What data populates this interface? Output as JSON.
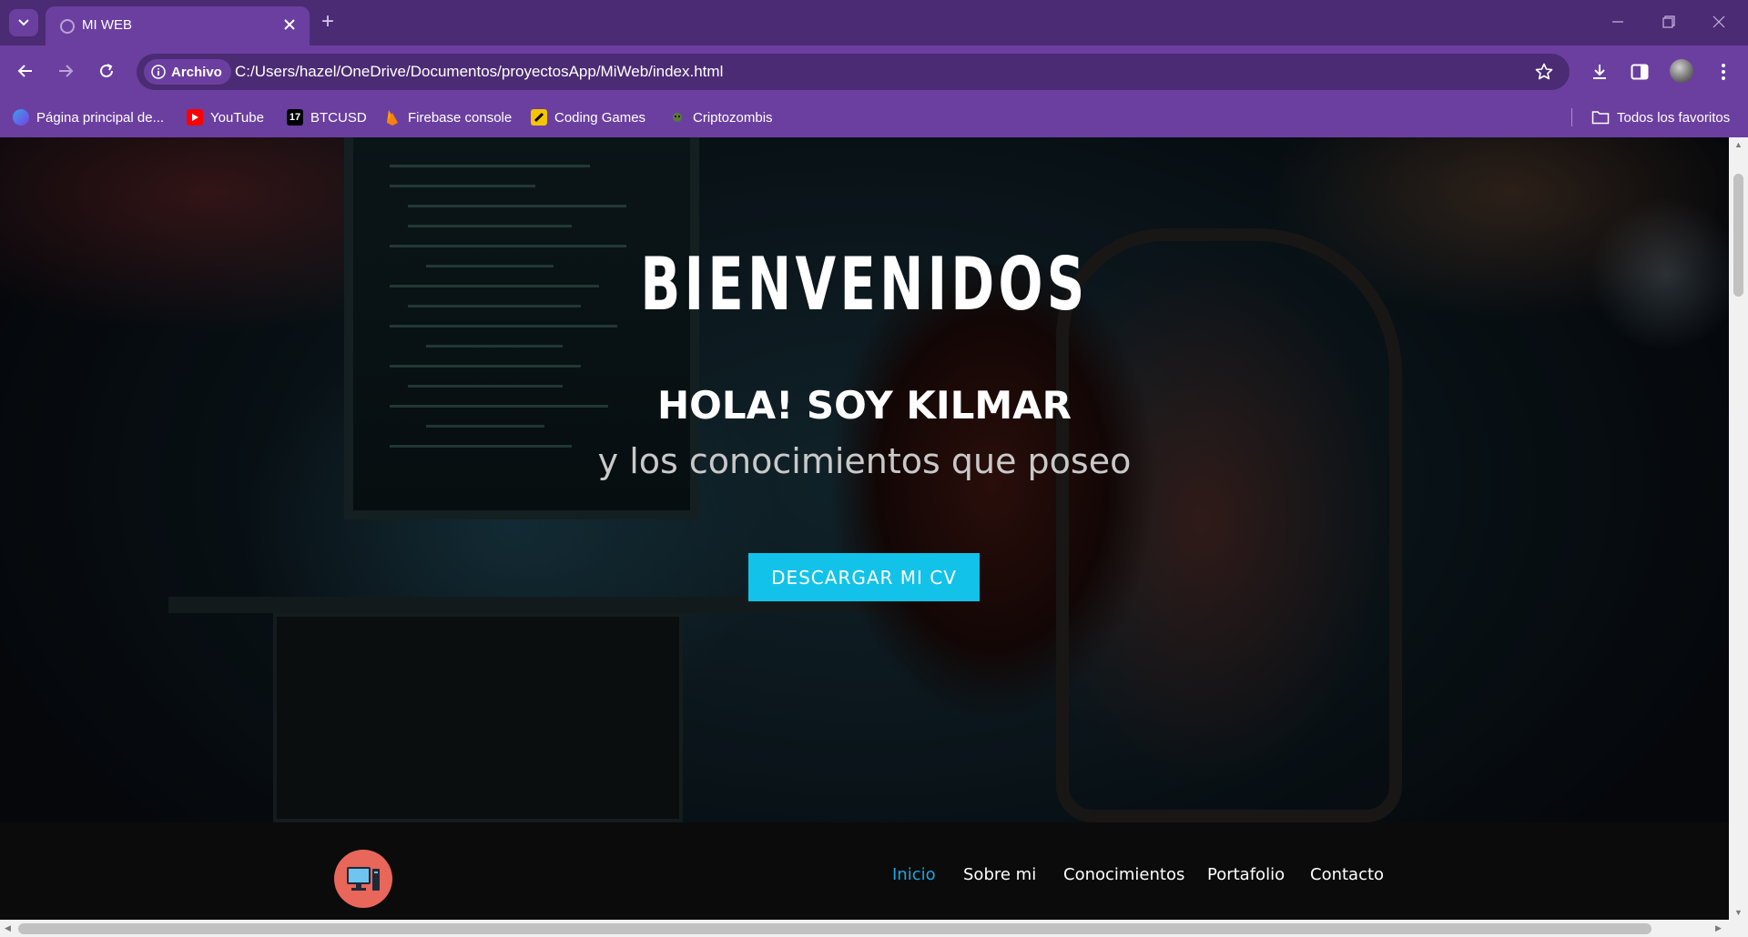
{
  "browser": {
    "tab": {
      "title": "MI WEB"
    },
    "address_bar": {
      "site_chip": "Archivo",
      "url": "C:/Users/hazel/OneDrive/Documentos/proyectosApp/MiWeb/index.html"
    },
    "bookmarks": [
      {
        "label": "Página principal de...",
        "icon": "edge-icon"
      },
      {
        "label": "YouTube",
        "icon": "youtube-icon"
      },
      {
        "label": "BTCUSD",
        "icon": "tradingview-icon"
      },
      {
        "label": "Firebase console",
        "icon": "firebase-icon"
      },
      {
        "label": "Coding Games",
        "icon": "coding-games-icon"
      },
      {
        "label": "Criptozombis",
        "icon": "zombie-icon"
      }
    ],
    "all_bookmarks_label": "Todos los favoritos",
    "colors": {
      "frame": "#4b2b73",
      "toolbar": "#6b3fa0"
    }
  },
  "page": {
    "hero": {
      "title": "BIENVENIDOS",
      "greeting": "HOLA! SOY KILMAR",
      "subtitle": "y los conocimientos que poseo",
      "cta_label": "DESCARGAR MI CV"
    },
    "nav": {
      "items": [
        {
          "label": "Inicio",
          "active": true
        },
        {
          "label": "Sobre mi",
          "active": false
        },
        {
          "label": "Conocimientos",
          "active": false
        },
        {
          "label": "Portafolio",
          "active": false
        },
        {
          "label": "Contacto",
          "active": false
        }
      ]
    },
    "colors": {
      "accent": "#12c2e9",
      "nav_active": "#1aa7e0",
      "logo_bg": "#e8665a",
      "nav_bg": "#0b0b0b"
    }
  }
}
